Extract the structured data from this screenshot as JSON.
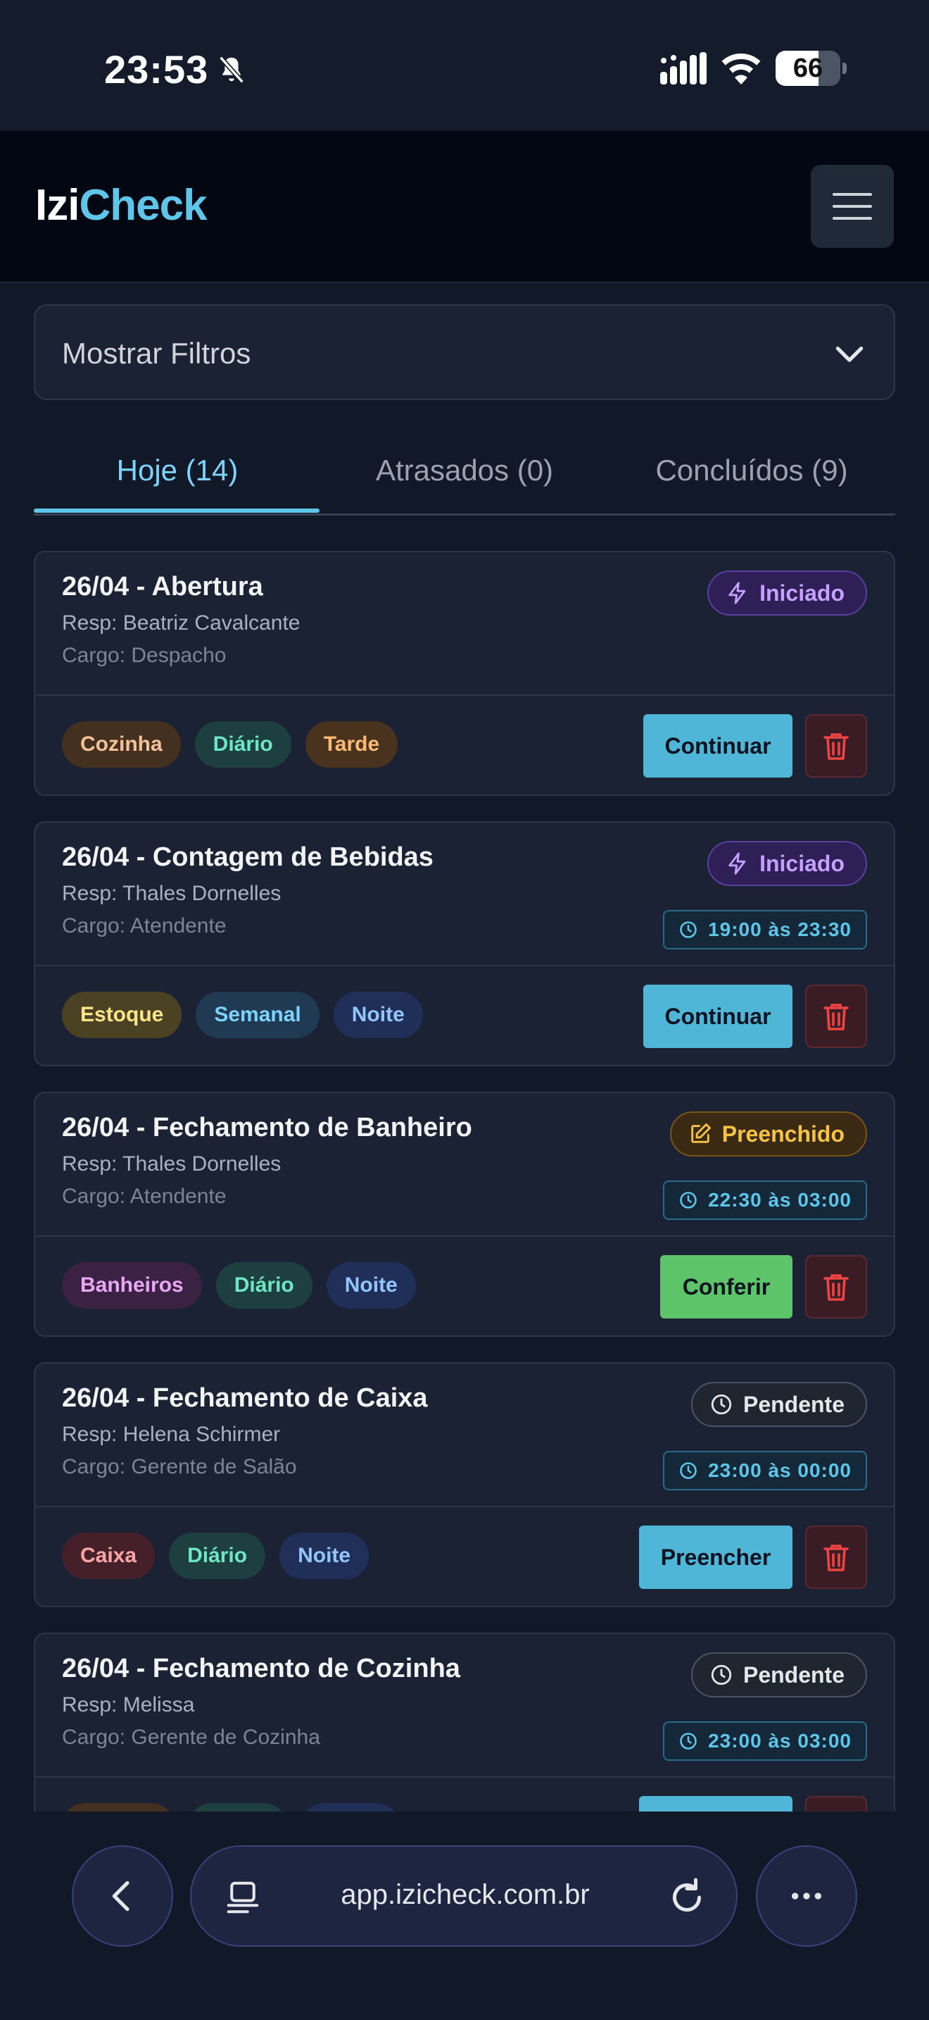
{
  "status_bar": {
    "time": "23:53",
    "battery": "66",
    "battery_level": 0.66
  },
  "app": {
    "logo_part1": "Izi",
    "logo_part2": "Check"
  },
  "filter": {
    "label": "Mostrar Filtros"
  },
  "tabs": [
    {
      "label": "Hoje (14)",
      "active": true
    },
    {
      "label": "Atrasados (0)",
      "active": false
    },
    {
      "label": "Concluídos (9)",
      "active": false
    }
  ],
  "cards": [
    {
      "title": "26/04 - Abertura",
      "resp": "Resp: Beatriz Cavalcante",
      "cargo": "Cargo: Despacho",
      "status": "Iniciado",
      "time": "",
      "tags": [
        "Cozinha",
        "Diário",
        "Tarde"
      ],
      "action": "Continuar"
    },
    {
      "title": "26/04 - Contagem de Bebidas",
      "resp": "Resp: Thales Dornelles",
      "cargo": "Cargo: Atendente",
      "status": "Iniciado",
      "time": "19:00 às 23:30",
      "tags": [
        "Estoque",
        "Semanal",
        "Noite"
      ],
      "action": "Continuar"
    },
    {
      "title": "26/04 - Fechamento de Banheiro",
      "resp": "Resp: Thales Dornelles",
      "cargo": "Cargo: Atendente",
      "status": "Preenchido",
      "time": "22:30 às 03:00",
      "tags": [
        "Banheiros",
        "Diário",
        "Noite"
      ],
      "action": "Conferir"
    },
    {
      "title": "26/04 - Fechamento de Caixa",
      "resp": "Resp: Helena Schirmer",
      "cargo": "Cargo: Gerente de Salão",
      "status": "Pendente",
      "time": "23:00 às 00:00",
      "tags": [
        "Caixa",
        "Diário",
        "Noite"
      ],
      "action": "Preencher"
    },
    {
      "title": "26/04 - Fechamento de Cozinha",
      "resp": "Resp: Melissa",
      "cargo": "Cargo: Gerente de Cozinha",
      "status": "Pendente",
      "time": "23:00 às 03:00",
      "tags": [
        "",
        "",
        ""
      ],
      "action": ""
    }
  ],
  "browser": {
    "url": "app.izicheck.com.br"
  },
  "icons": {
    "status_iniciado": "lightning-icon",
    "status_preenchido": "edit-icon",
    "status_pendente": "clock-icon",
    "time": "clock-icon",
    "delete": "trash-icon"
  },
  "colors": {
    "accent": "#5ec6e8",
    "background": "#111827",
    "card": "#1a2233",
    "continue_button": "#4fb6d8",
    "confer_button": "#5dc46a"
  }
}
